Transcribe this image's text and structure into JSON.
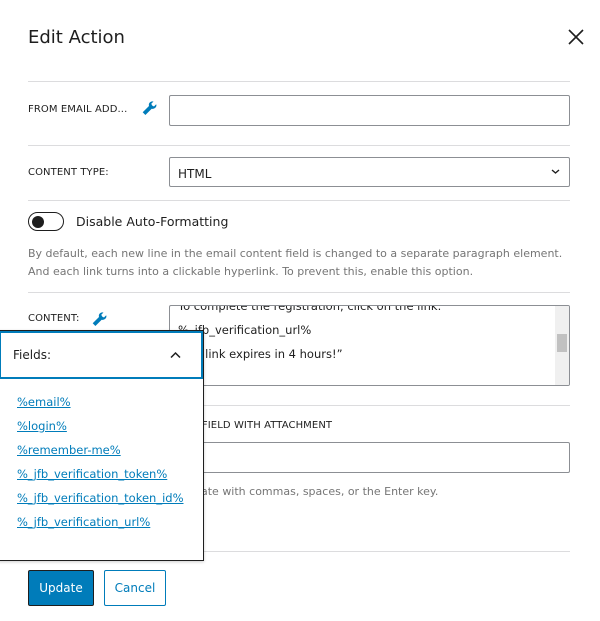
{
  "modal": {
    "title": "Edit Action"
  },
  "from_email": {
    "label": "FROM EMAIL ADD...",
    "value": ""
  },
  "content_type": {
    "label": "CONTENT TYPE:",
    "value": "HTML"
  },
  "auto_format": {
    "label": "Disable Auto-Formatting",
    "enabled": false,
    "help": "By default, each new line in the email content field is changed to a separate paragraph element. And each link turns into a clickable hyperlink. To prevent this, enable this option."
  },
  "content": {
    "label": "CONTENT:",
    "lines": [
      "To complete the registration, click on the link:",
      "%_jfb_verification_url%",
      "This link expires in 4 hours!”"
    ]
  },
  "attachment": {
    "label": "FORM FIELD WITH ATTACHMENT",
    "value": "",
    "help": "Separate with commas, spaces, or the Enter key."
  },
  "fields_popover": {
    "title": "Fields:",
    "items": [
      "%email%",
      "%login%",
      "%remember-me%",
      "%_jfb_verification_token%",
      "%_jfb_verification_token_id%",
      "%_jfb_verification_url%"
    ]
  },
  "buttons": {
    "update": "Update",
    "cancel": "Cancel"
  },
  "colors": {
    "accent": "#007cba"
  }
}
